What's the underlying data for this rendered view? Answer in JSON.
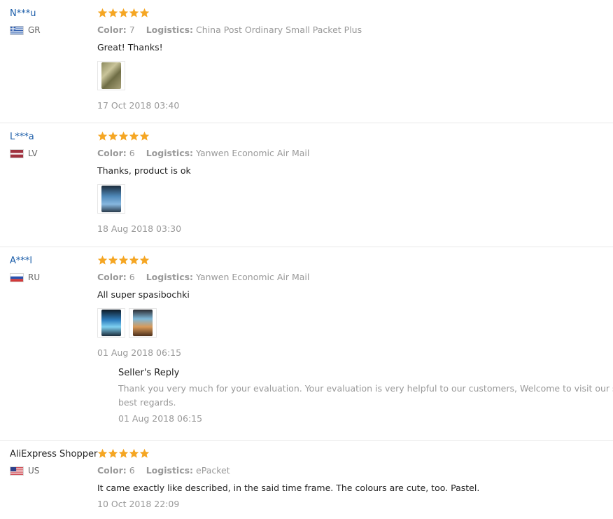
{
  "colors": {
    "name_link": "#1a5ca8",
    "star": "#f5a623",
    "muted": "#999999"
  },
  "labels": {
    "color": "Color:",
    "logistics": "Logistics:",
    "seller_reply": "Seller's Reply"
  },
  "reviews": [
    {
      "user": "N***u",
      "country": "GR",
      "flag": "greece-flag-icon",
      "rating": 5,
      "color": "7",
      "logistics": "China Post Ordinary Small Packet Plus",
      "text": "Great! Thanks!",
      "date": "17 Oct 2018 03:40",
      "photos": 1
    },
    {
      "user": "L***a",
      "country": "LV",
      "flag": "latvia-flag-icon",
      "rating": 5,
      "color": "6",
      "logistics": "Yanwen Economic Air Mail",
      "text": "Thanks, product is ok",
      "date": "18 Aug 2018 03:30",
      "photos": 1
    },
    {
      "user": "A***l",
      "country": "RU",
      "flag": "russia-flag-icon",
      "rating": 5,
      "color": "6",
      "logistics": "Yanwen Economic Air Mail",
      "text": "All super spasibochki",
      "date": "01 Aug 2018 06:15",
      "photos": 2,
      "seller_reply": {
        "line1": "Thank you very much for your evaluation. Your evaluation is very helpful to our customers, Welcome to visit our store",
        "line2": "best regards.",
        "date": "01 Aug 2018 06:15"
      }
    },
    {
      "user": "AliExpress Shopper",
      "country": "US",
      "flag": "usa-flag-icon",
      "rating": 5,
      "color": "6",
      "logistics": "ePacket",
      "text": "It came exactly like described, in the said time frame. The colours are cute, too. Pastel.",
      "date": "10 Oct 2018 22:09",
      "photos": 0
    }
  ]
}
